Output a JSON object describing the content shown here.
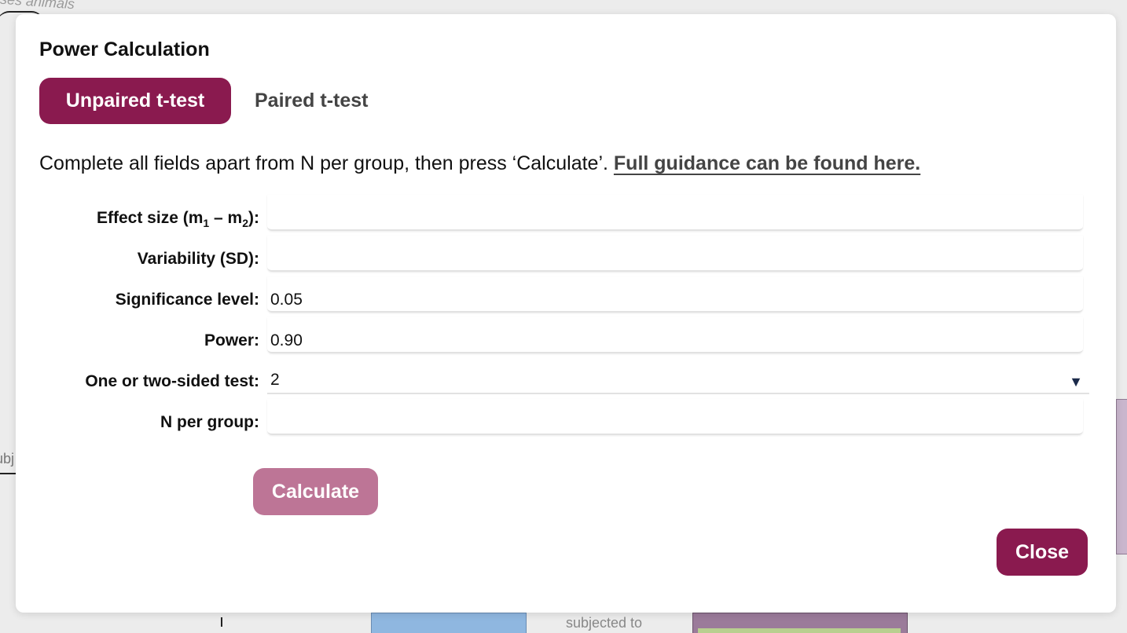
{
  "background": {
    "top_fragment": "ses animals",
    "left_fragment": "ubj",
    "bottom_fragment": "subjected to",
    "right_fragment": "c"
  },
  "modal": {
    "title": "Power Calculation",
    "tabs": [
      {
        "label": "Unpaired t-test",
        "active": true
      },
      {
        "label": "Paired t-test",
        "active": false
      }
    ],
    "instructions": "Complete all fields apart from N per group, then press ‘Calculate’.",
    "guidance_link": "Full guidance can be found here.",
    "fields": {
      "effect_size": {
        "label_prefix": "Effect size (m",
        "sub1": "1",
        "label_mid": " – m",
        "sub2": "2",
        "label_suffix": "):",
        "value": ""
      },
      "variability": {
        "label": "Variability (SD):",
        "value": ""
      },
      "significance": {
        "label": "Significance level:",
        "value": "0.05"
      },
      "power": {
        "label": "Power:",
        "value": "0.90"
      },
      "sides": {
        "label": "One or two-sided test:",
        "value": "2",
        "arrow": "▼"
      },
      "n_per_group": {
        "label": "N per group:",
        "value": ""
      }
    },
    "calculate_label": "Calculate",
    "close_label": "Close"
  },
  "colors": {
    "accent": "#8a1a4f",
    "accent_light": "#bd7596"
  }
}
